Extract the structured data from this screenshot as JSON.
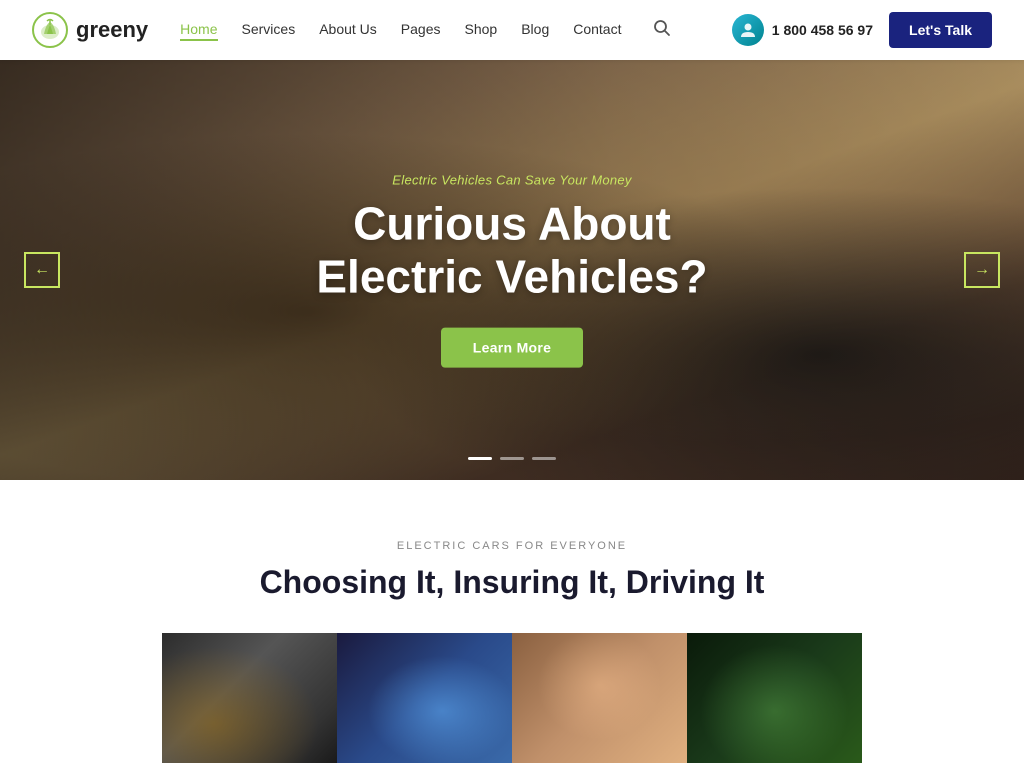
{
  "logo": {
    "text": "greeny",
    "icon": "leaf-icon"
  },
  "nav": {
    "links": [
      {
        "label": "Home",
        "active": true
      },
      {
        "label": "Services",
        "active": false
      },
      {
        "label": "About Us",
        "active": false
      },
      {
        "label": "Pages",
        "active": false
      },
      {
        "label": "Shop",
        "active": false
      },
      {
        "label": "Blog",
        "active": false
      },
      {
        "label": "Contact",
        "active": false
      }
    ]
  },
  "phone": {
    "number": "1 800 458 56 97"
  },
  "cta_button": "Let's Talk",
  "hero": {
    "eyebrow": "Electric Vehicles Can Save Your Money",
    "title": "Curious About\nElectric Vehicles?",
    "button_label": "Learn More",
    "arrow_left": "←",
    "arrow_right": "→"
  },
  "section": {
    "eyebrow": "ELECTRIC CARS FOR EVERYONE",
    "title": "Choosing It, Insuring It, Driving It",
    "cards": [
      {
        "alt": "Electric car exterior"
      },
      {
        "alt": "EV charging port"
      },
      {
        "alt": "Happy EV passengers"
      },
      {
        "alt": "Green plant EV concept"
      }
    ]
  }
}
